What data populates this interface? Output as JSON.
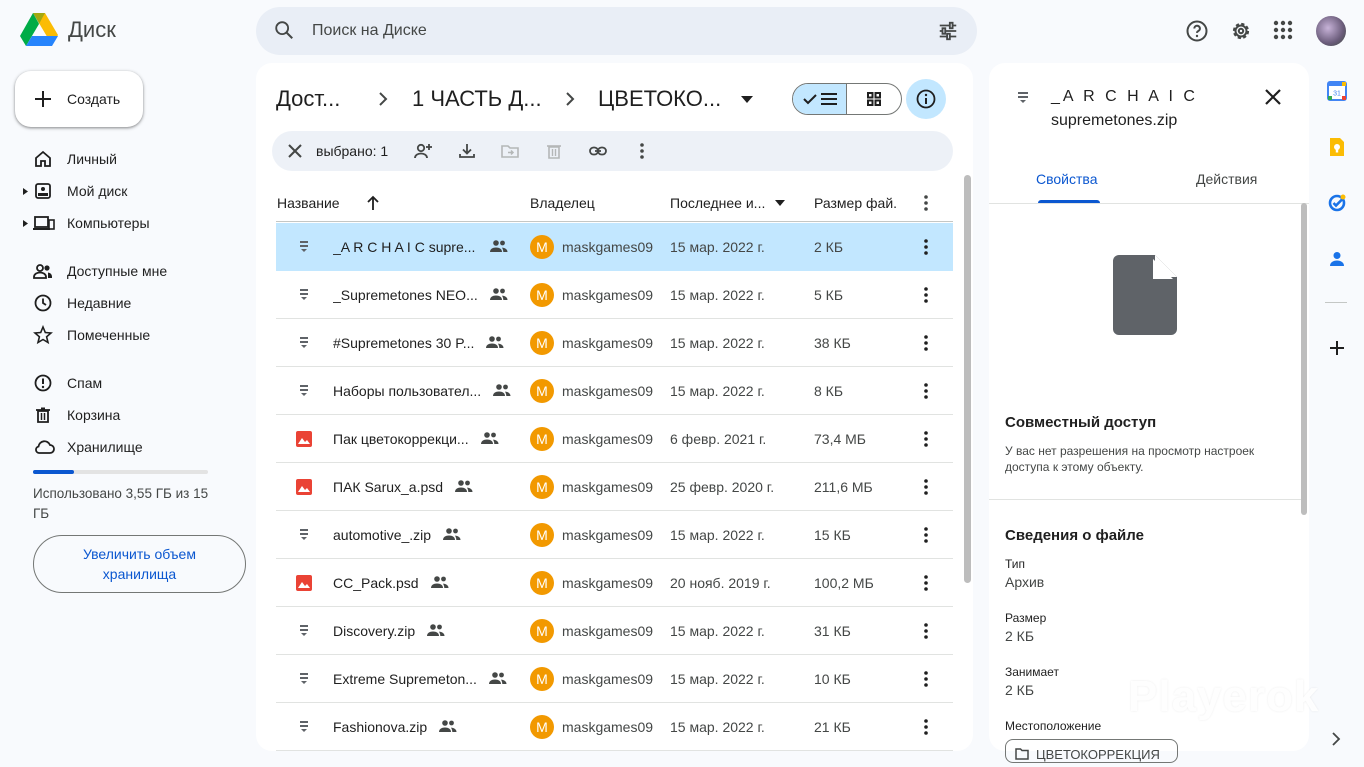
{
  "app": {
    "name": "Диск"
  },
  "search": {
    "placeholder": "Поиск на Диске"
  },
  "create_label": "Создать",
  "nav": [
    {
      "label": "Личный",
      "icon": "home-icon"
    },
    {
      "label": "Мой диск",
      "icon": "my-drive-icon"
    },
    {
      "label": "Компьютеры",
      "icon": "computers-icon"
    },
    {
      "label": "Доступные мне",
      "icon": "shared-with-me-icon"
    },
    {
      "label": "Недавние",
      "icon": "clock-icon"
    },
    {
      "label": "Помеченные",
      "icon": "star-icon"
    },
    {
      "label": "Спам",
      "icon": "spam-icon"
    },
    {
      "label": "Корзина",
      "icon": "trash-icon"
    },
    {
      "label": "Хранилище",
      "icon": "cloud-icon"
    }
  ],
  "storage": {
    "used_text": "Использовано 3,55 ГБ из 15 ГБ",
    "used_fraction": 0.237,
    "upgrade_label": "Увеличить объем хранилища"
  },
  "breadcrumb": [
    "Дост...",
    "1 ЧАСТЬ Д...",
    "ЦВЕТОКО..."
  ],
  "selection": {
    "text": "выбрано: 1"
  },
  "columns": {
    "name": "Название",
    "owner": "Владелец",
    "modified": "Последнее и...",
    "size": "Размер фай..."
  },
  "files": [
    {
      "name": "_A R C H A I C supre...",
      "type": "zip",
      "owner": "maskgames09",
      "date": "15 мар. 2022 г.",
      "size": "2 КБ",
      "selected": true
    },
    {
      "name": "_Supremetones NEO...",
      "type": "zip",
      "owner": "maskgames09",
      "date": "15 мар. 2022 г.",
      "size": "5 КБ"
    },
    {
      "name": "#Supremetones 30 P...",
      "type": "zip",
      "owner": "maskgames09",
      "date": "15 мар. 2022 г.",
      "size": "38 КБ"
    },
    {
      "name": "Наборы пользовател...",
      "type": "zip",
      "owner": "maskgames09",
      "date": "15 мар. 2022 г.",
      "size": "8 КБ"
    },
    {
      "name": "Пак цветокоррекци...",
      "type": "image",
      "owner": "maskgames09",
      "date": "6 февр. 2021 г.",
      "size": "73,4 МБ"
    },
    {
      "name": "ПАК Sarux_a.psd",
      "type": "image",
      "owner": "maskgames09",
      "date": "25 февр. 2020 г.",
      "size": "211,6 МБ"
    },
    {
      "name": "automotive_.zip",
      "type": "zip",
      "owner": "maskgames09",
      "date": "15 мар. 2022 г.",
      "size": "15 КБ"
    },
    {
      "name": "CC_Pack.psd",
      "type": "image",
      "owner": "maskgames09",
      "date": "20 нояб. 2019 г.",
      "size": "100,2 МБ"
    },
    {
      "name": "Discovery.zip",
      "type": "zip",
      "owner": "maskgames09",
      "date": "15 мар. 2022 г.",
      "size": "31 КБ"
    },
    {
      "name": "Extreme Supremeton...",
      "type": "zip",
      "owner": "maskgames09",
      "date": "15 мар. 2022 г.",
      "size": "10 КБ"
    },
    {
      "name": "Fashionova.zip",
      "type": "zip",
      "owner": "maskgames09",
      "date": "15 мар. 2022 г.",
      "size": "21 КБ"
    }
  ],
  "details": {
    "title_line1": "_A R C H A I C",
    "title_line2": "supremetones.zip",
    "tabs": [
      "Свойства",
      "Действия"
    ],
    "sharing_heading": "Совместный доступ",
    "sharing_note": "У вас нет разрешения на просмотр настроек доступа к этому объекту.",
    "file_info_heading": "Сведения о файле",
    "type_label": "Тип",
    "type_value": "Архив",
    "size_label": "Размер",
    "size_value": "2 КБ",
    "storage_label": "Занимает",
    "storage_value": "2 КБ",
    "location_label": "Местоположение",
    "location_value": "ЦВЕТОКОРРЕКЦИЯ"
  },
  "watermark": "Playerok",
  "colors": {
    "accent": "#0b57d0",
    "selected_row": "#c2e7ff",
    "owner_avatar": "#f29900",
    "image_icon": "#ea4335"
  }
}
